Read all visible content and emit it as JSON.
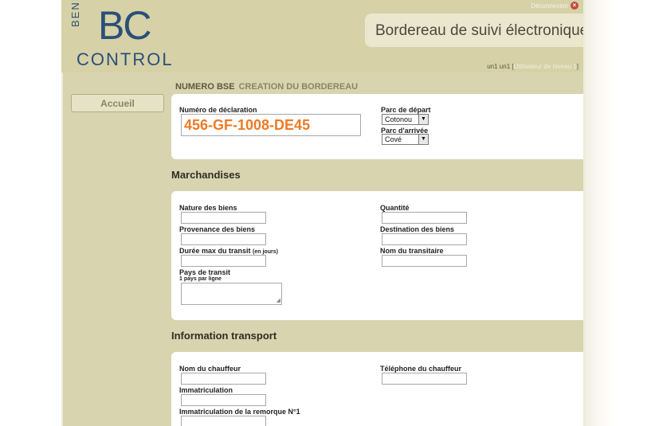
{
  "header": {
    "logo": {
      "benin": "BENIN",
      "bc": "BC",
      "control": "CONTROL"
    },
    "title": "Bordereau de suivi électronique",
    "logout_label": "Déconnexion",
    "user_name": "un1 un1",
    "user_level_prefix": "[",
    "user_level": "Utilisateur de niveau 1",
    "user_level_suffix": "]"
  },
  "sidebar": {
    "home_label": "Accueil"
  },
  "bse": {
    "title": "NUMERO BSE",
    "subtitle": "CREATION DU BORDEREAU",
    "declaration_label": "Numéro de déclaration",
    "declaration_value": "456-GF-1008-DE45",
    "departure_label": "Parc de départ",
    "departure_value": "Cotonou",
    "arrival_label": "Parc d'arrivée",
    "arrival_value": "Cové"
  },
  "merchandise": {
    "title": "Marchandises",
    "nature_label": "Nature des biens",
    "quantity_label": "Quantité",
    "origin_label": "Provenance des biens",
    "destination_label": "Destination des biens",
    "duration_label": "Durée max du transit",
    "duration_unit": "(en jours)",
    "forwarder_label": "Nom du transitaire",
    "transit_label": "Pays de transit",
    "transit_hint": "1 pays par ligne"
  },
  "transport": {
    "title": "Information transport",
    "driver_label": "Nom du chauffeur",
    "phone_label": "Téléphone du chauffeur",
    "registration_label": "Immatriculation",
    "trailer_label": "Immatriculation de la remorque N°1"
  }
}
